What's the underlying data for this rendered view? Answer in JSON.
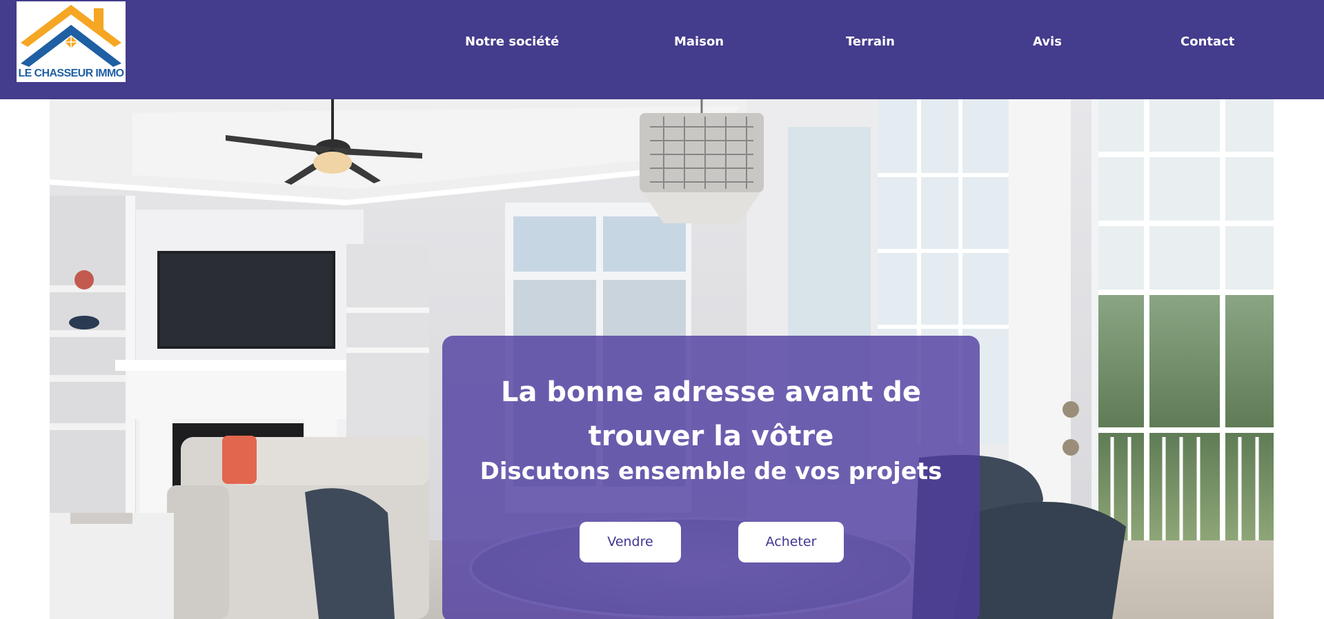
{
  "header": {
    "background_color": "#443c8c",
    "logo": {
      "text": "LE CHASSEUR IMMO",
      "roof_color_orange": "#f5a623",
      "roof_color_blue": "#1f5fa3"
    },
    "nav": [
      {
        "label": "Notre société"
      },
      {
        "label": "Maison"
      },
      {
        "label": "Terrain"
      },
      {
        "label": "Avis"
      },
      {
        "label": "Contact"
      }
    ]
  },
  "hero": {
    "title": "La bonne adresse avant de trouver la vôtre",
    "subtitle": "Discutons ensemble de vos projets",
    "buttons": [
      {
        "label": "Vendre"
      },
      {
        "label": "Acheter"
      }
    ],
    "overlay_color": "#503ca0",
    "button_text_color": "#3f3592"
  }
}
